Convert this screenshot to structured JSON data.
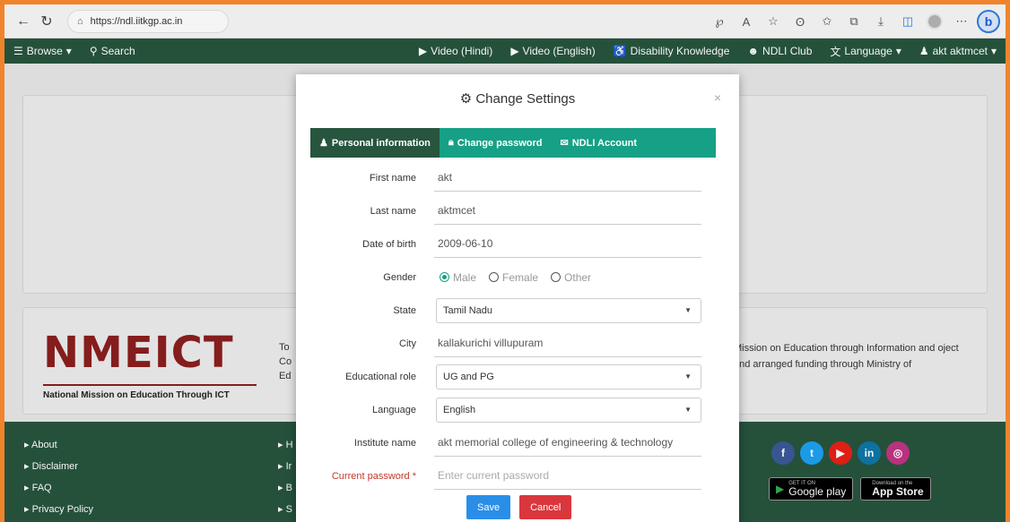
{
  "browser": {
    "url": "https://ndl.iitkgp.ac.in",
    "icons": [
      "back-icon",
      "refresh-icon",
      "lock-icon",
      "read-aloud-icon",
      "text-size-icon",
      "favorite-add-icon",
      "copilot-icon",
      "favorites-icon",
      "collections-icon",
      "downloads-icon",
      "outlook-icon",
      "profile-icon",
      "more-icon",
      "bing-icon"
    ]
  },
  "sitenav": {
    "browse": "Browse",
    "search": "Search",
    "video_hindi": "Video (Hindi)",
    "video_english": "Video (English)",
    "disability": "Disability Knowledge",
    "club": "NDLI Club",
    "language": "Language",
    "user": "akt aktmcet"
  },
  "nmeict": {
    "logo": "NMEICT",
    "subtitle": "National Mission on Education Through ICT",
    "trunc_lines": [
      "To",
      "Co",
      "Ed"
    ],
    "desc": "Mission on Education through Information and oject and arranged funding through Ministry of"
  },
  "footer": {
    "col1": [
      "About",
      "Disclaimer",
      "FAQ",
      "Privacy Policy"
    ],
    "col2": [
      "H",
      "Ir",
      "B",
      "S"
    ],
    "google_play_small": "GET IT ON",
    "google_play": "Google play",
    "app_store_small": "Download on the",
    "app_store": "App Store"
  },
  "modal": {
    "title": "Change Settings",
    "close": "×",
    "tabs": [
      "Personal information",
      "Change password",
      "NDLI Account"
    ],
    "fields": {
      "first_name": {
        "label": "First name",
        "value": "akt"
      },
      "last_name": {
        "label": "Last name",
        "value": "aktmcet"
      },
      "dob": {
        "label": "Date of birth",
        "value": "2009-06-10"
      },
      "gender": {
        "label": "Gender",
        "options": [
          "Male",
          "Female",
          "Other"
        ],
        "selected": "Male"
      },
      "state": {
        "label": "State",
        "value": "Tamil Nadu"
      },
      "city": {
        "label": "City",
        "value": "kallakurichi villupuram"
      },
      "role": {
        "label": "Educational role",
        "value": "UG and PG"
      },
      "language": {
        "label": "Language",
        "value": "English"
      },
      "institute": {
        "label": "Institute name",
        "value": "akt memorial college of engineering & technology"
      },
      "password": {
        "label": "Current password *",
        "placeholder": "Enter current password"
      }
    },
    "save": "Save",
    "cancel": "Cancel"
  },
  "colors": {
    "accent": "#16a085",
    "nav": "#27553e",
    "frame": "#f0842c"
  }
}
